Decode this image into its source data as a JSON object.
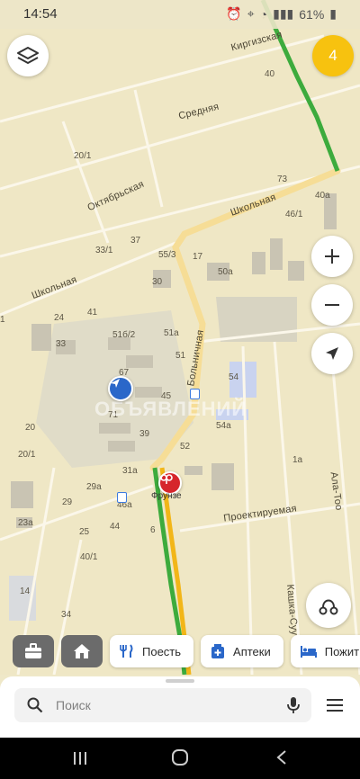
{
  "status_bar": {
    "time": "14:54",
    "battery": "61%"
  },
  "map": {
    "streets": [
      "Киргизская",
      "Средняя",
      "Октябрьская",
      "Школьная",
      "Школьная",
      "Больничная",
      "Проектируемая",
      "Ала-Тоо",
      "Кашка-Суу"
    ],
    "house_numbers": [
      "40",
      "20/1",
      "33/1",
      "37",
      "55/3",
      "17",
      "50a",
      "30",
      "24",
      "41",
      "51б/2",
      "51a",
      "51",
      "67",
      "54",
      "45",
      "71",
      "54a",
      "39",
      "52",
      "20",
      "20/1",
      "31a",
      "29a",
      "29",
      "46a",
      "44",
      "25",
      "6",
      "40/1",
      "23a",
      "14",
      "34",
      "73",
      "40a",
      "46/1",
      "1a",
      "33",
      "1"
    ],
    "metro_station": "Фрунзе",
    "watermark": "ОБЪЯВЛЕНИЙ",
    "traffic_colors": {
      "free": "#3dab3d",
      "slow": "#f2b618",
      "main_road": "#f5d98a"
    }
  },
  "controls": {
    "badge_count": "4"
  },
  "chips": [
    {
      "label": "Поесть",
      "icon": "fork-knife-icon"
    },
    {
      "label": "Аптеки",
      "icon": "pharmacy-icon"
    },
    {
      "label": "Пожить",
      "icon": "bed-icon"
    }
  ],
  "search": {
    "placeholder": "Поиск"
  }
}
